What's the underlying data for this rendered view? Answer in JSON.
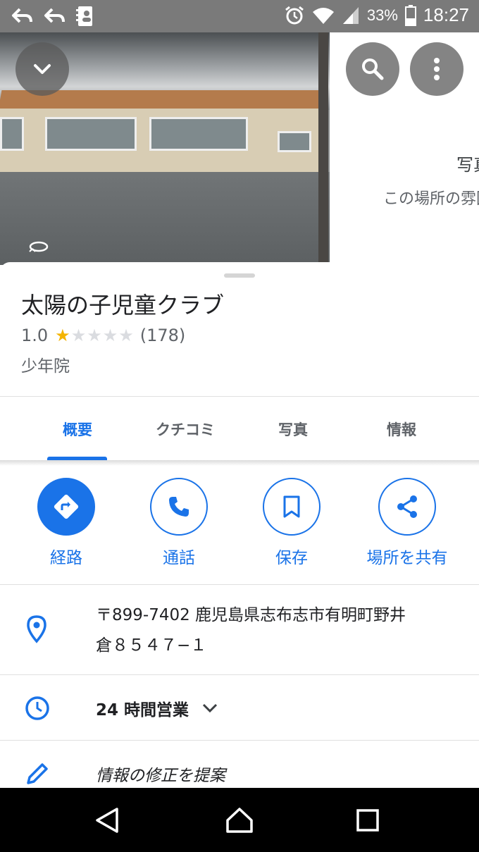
{
  "status_bar": {
    "time": "18:27",
    "battery": "33%",
    "icons": [
      "back-arrow-icon",
      "back-arrow-icon",
      "contact-card-icon",
      "alarm-icon",
      "wifi-icon",
      "signal-icon",
      "battery-icon"
    ]
  },
  "header": {
    "photo_side_title": "写真",
    "photo_side_subtitle": "この場所の雰囲気"
  },
  "place": {
    "name": "太陽の子児童クラブ",
    "rating": "1.0",
    "rating_value": 1,
    "rating_max": 5,
    "review_count": "(178)",
    "category": "少年院"
  },
  "tabs": [
    {
      "label": "概要",
      "active": true
    },
    {
      "label": "クチコミ",
      "active": false
    },
    {
      "label": "写真",
      "active": false
    },
    {
      "label": "情報",
      "active": false
    }
  ],
  "actions": [
    {
      "label": "経路",
      "icon": "directions-icon"
    },
    {
      "label": "通話",
      "icon": "phone-icon"
    },
    {
      "label": "保存",
      "icon": "bookmark-icon"
    },
    {
      "label": "場所を共有",
      "icon": "share-icon"
    }
  ],
  "details": {
    "address_line1": "〒899-7402 鹿児島県志布志市有明町野井",
    "address_line2": "倉８５４７−１",
    "hours": "24 時間営業",
    "suggest_edit": "情報の修正を提案"
  },
  "colors": {
    "accent": "#1a73e8",
    "star": "#f4b400",
    "status_bar": "#7a7a7a",
    "nav_bar": "#000000"
  }
}
